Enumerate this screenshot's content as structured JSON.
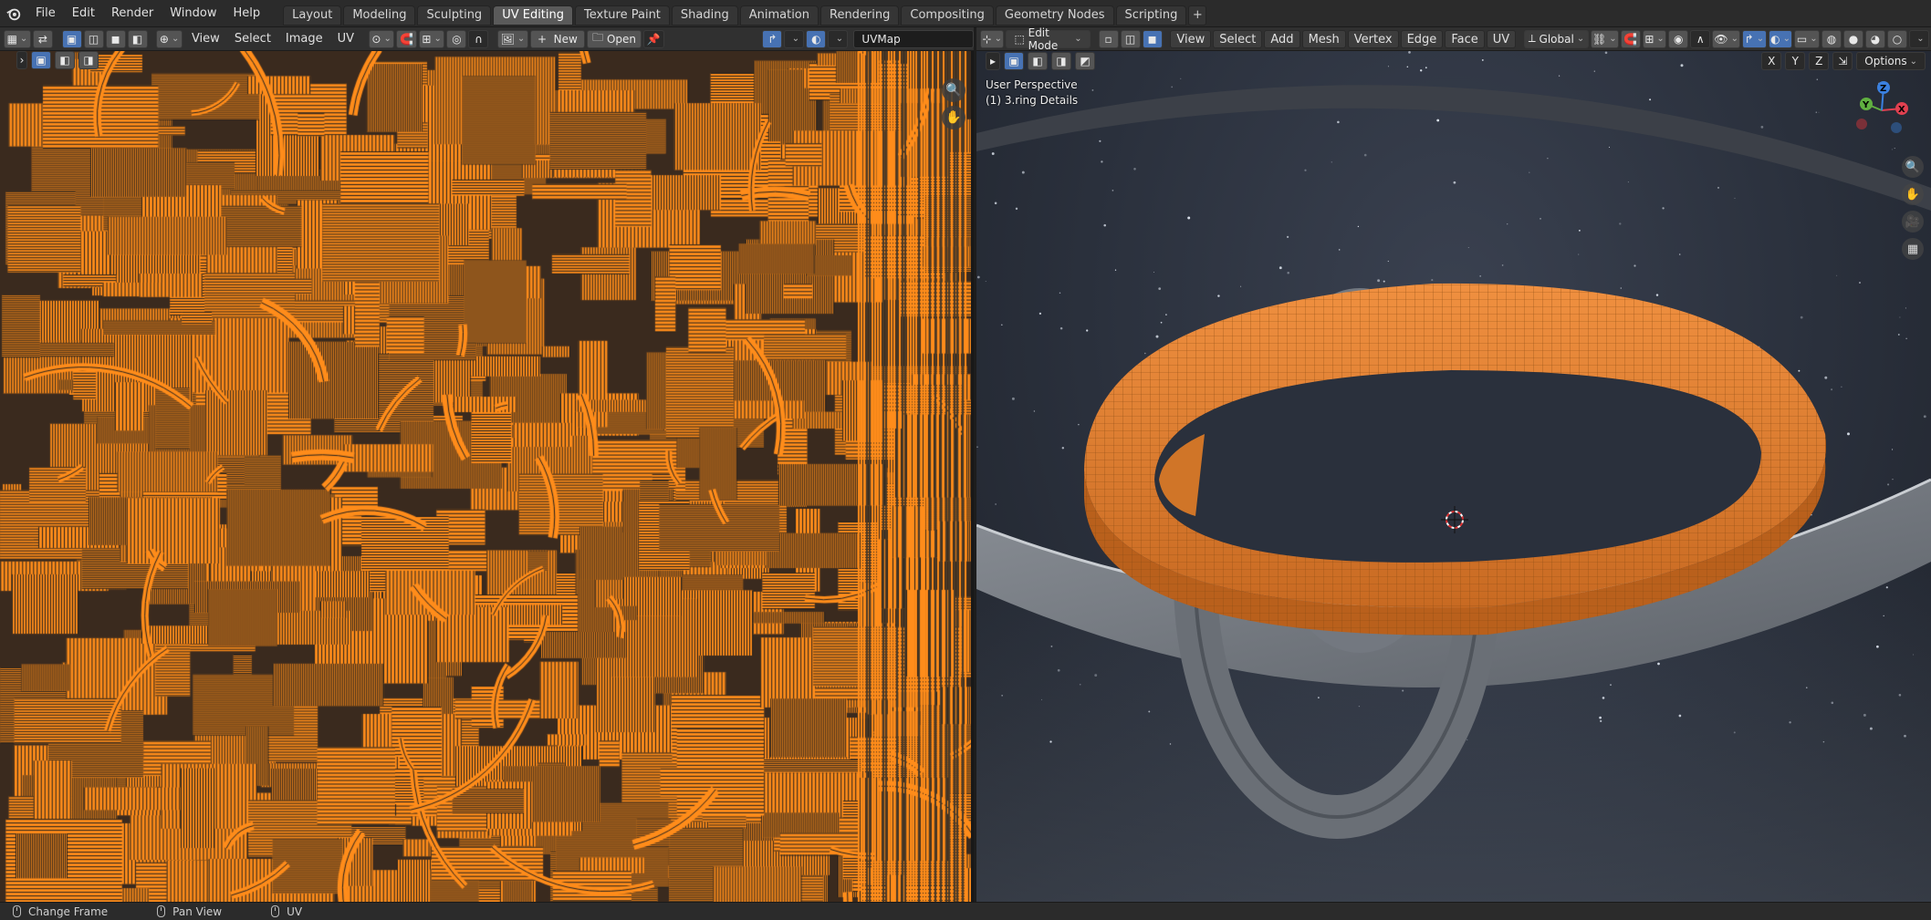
{
  "topbar": {
    "menus": [
      "File",
      "Edit",
      "Render",
      "Window",
      "Help"
    ],
    "workspace_tabs": [
      "Layout",
      "Modeling",
      "Sculpting",
      "UV Editing",
      "Texture Paint",
      "Shading",
      "Animation",
      "Rendering",
      "Compositing",
      "Geometry Nodes",
      "Scripting"
    ],
    "active_tab": "UV Editing",
    "add_tab": "+"
  },
  "uv_editor": {
    "menus": [
      "View",
      "Select",
      "Image",
      "UV"
    ],
    "new_label": "New",
    "open_label": "Open",
    "uvmap_value": "UVMap",
    "colors": {
      "island": "#ff8c1a",
      "background": "#3a2a1e",
      "edge": "#1e1e1e"
    }
  },
  "viewport": {
    "mode": "Edit Mode",
    "menus": [
      "View",
      "Select",
      "Add",
      "Mesh",
      "Vertex",
      "Edge",
      "Face",
      "UV"
    ],
    "transform_orientation": "Global",
    "axis_buttons": [
      "X",
      "Y",
      "Z"
    ],
    "options_label": "Options",
    "perspective_label": "User Perspective",
    "object_label": "(1) 3.ring Details",
    "gizmo_axes": [
      "X",
      "Y",
      "Z"
    ],
    "colors": {
      "selection": "#e8852e",
      "mesh": "#7a7f86",
      "sky": "#2a303c"
    }
  },
  "statusbar": {
    "items": [
      "Change Frame",
      "Pan View",
      "UV"
    ]
  }
}
